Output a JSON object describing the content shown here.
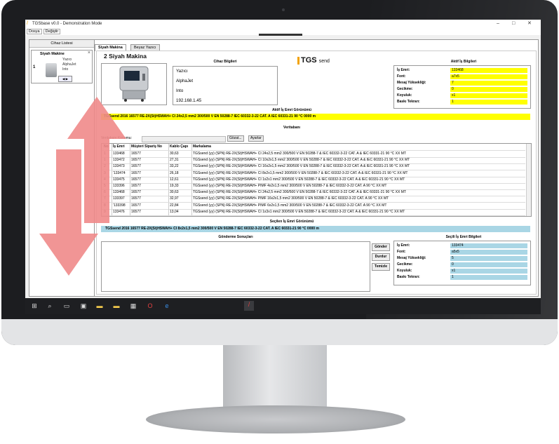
{
  "window": {
    "title": "TGSbase v0.0 - Demonstration Mode",
    "minimize": "–",
    "maximize": "□",
    "close": "✕"
  },
  "menu": [
    "Dosya",
    "Değiştir"
  ],
  "left_panel": {
    "header": "Cihaz Listesi",
    "card": {
      "name": "Siyah Makine",
      "number": "1",
      "lines": [
        "Yazıcı",
        "AlphaJet",
        "Into"
      ],
      "control": "◀ ▶"
    }
  },
  "tabs": [
    "Siyah Makina",
    "Beyaz Yazıcı"
  ],
  "machine_title": "2   Siyah Makina",
  "cihaz": {
    "header": "Cihaz Bilgileri",
    "lines": [
      "Yazıcı",
      "AlphaJet",
      "Into",
      "192.168.1.45"
    ]
  },
  "logo": {
    "brand": "TGS",
    "suffix": "send"
  },
  "aktif": {
    "header": "Aktif İş Bilgileri",
    "rows": [
      {
        "label": "İş Emri:",
        "value": "133468"
      },
      {
        "label": "Font:",
        "value": "a7x5"
      },
      {
        "label": "Mesaj Yüksekliği:",
        "value": "7"
      },
      {
        "label": "Gecikme:",
        "value": "0"
      },
      {
        "label": "Koyuluk:",
        "value": "x1"
      },
      {
        "label": "Baskı Tekrarı:",
        "value": "1"
      }
    ]
  },
  "aktif_band": {
    "label": "Aktif İş Emri Görünümü",
    "text": "TGSsend 2016 16577 RE-2X(St)HSWAH+ CI 24x2,5 mm2 300/500 V EN 50288-7 IEC 60332-3-22 CAT. A IEC 60331-21 90 °C 0000 m"
  },
  "veritabani": {
    "label": "Veritabanı",
    "konum_label": "Veritabanı Konumu:",
    "gozat": "Gözat...",
    "ayarlar": "Ayarlar",
    "columns": [
      "No",
      "İş Emri",
      "Müşteri Sipariş No",
      "Kablo Çapı",
      "Markalama"
    ],
    "rows": [
      [
        "1",
        "133468",
        "16577",
        "30,63",
        "TGSsend (yy) (SPN) RE-2X(St)HSWAH+ CI 24x2,5 mm2 300/500 V EN 50288-7 & IEC 60332-3-22 CAT. A & IEC 60331-21 90 °C XX MT"
      ],
      [
        "1",
        "133472",
        "16577",
        "27,31",
        "TGSsend (yy) (SPN) RE-2X(St)HSWAH+ CI 10x2x1,5 mm2 300/500 V EN 50288-7 & IEC 60332-3-22 CAT. A & IEC 60331-21 90 °C XX MT"
      ],
      [
        "2",
        "133473",
        "16577",
        "33,22",
        "TGSsend (yy) (SPN) RE-2X(St)HSWAH+ CI 16x2x1,5 mm2 300/500 V EN 50288-7 & IEC 60332-3-22 CAT. A & IEC 60331-21 90 °C XX MT"
      ],
      [
        "3",
        "'133474",
        "16577",
        "26,18",
        "TGSsend (yy) (SPN) RE-2X(St)HSWAH+ CI 8x2x1,5 mm2 300/500 V EN 50288-7 & IEC 60332-3-22 CAT. A & IEC 60331-21 90 °C XX MT"
      ],
      [
        "4",
        "133475",
        "16577",
        "12,61",
        "TGSsend (yy) (SPN) RE-2X(St)HSWAH+ CI 1x2x1 mm2 300/500 V EN 50288-7 & IEC 60332-3-22 CAT. A & IEC 60331-21 90 °C XX MT"
      ],
      [
        "5",
        "133396",
        "16577",
        "19,33",
        "TGSsend (yy) (SPN) RE-2X(St)HSWAH+ PIMF 4x2x1,5 mm2 300/500 V EN 50288-7 & IEC 60332-3-22 CAT. A 90 °C XX MT"
      ],
      [
        "6",
        "133468",
        "16577",
        "30,63",
        "TGSsend (yy) (SPN) RE-2X(St)HSWAH+ CI 24x2,5 mm2 300/500 V EN 50288-7 & IEC 60332-3-22 CAT. A & IEC 60331-21 90 °C XX MT"
      ],
      [
        "7",
        "133397",
        "16577",
        "32,97",
        "TGSsend (yy) (SPN) RE-2X(St)HSWAH+ PIMF 16x2x1,5 mm2 300/500 V EN 50288-7 & IEC 60332-3-22 CAT. A 90 °C XX MT"
      ],
      [
        "8",
        "'133398",
        "16577",
        "22,84",
        "TGSsend (yy) (SPN) RE-2X(St)HSWAH+ PIMF 6x2x1,5 mm2 300/500 V EN 50288-7 & IEC 60332-3-22 CAT. A 90 °C XX MT"
      ],
      [
        "9",
        "133476",
        "16577",
        "13,04",
        "TGSsend (yy) (SPN) RE-2X(St)HSWAH+ CI 1x3x1 mm2 300/500 V EN 50288-7 & IEC 60332-3-22 CAT. A & IEC 60331-21 90 °C XX MT"
      ]
    ]
  },
  "secilen_band": {
    "label": "Seçilen İş Emri Görünümü",
    "text": "TGSsend 2016 16577 RE-2X(St)HSWAH+ CI 8x2x1,5 mm2 300/500 V EN 50288-7 IEC 60332-3-22 CAT. A IEC 60331-21 90 °C 0000 m"
  },
  "gonderme": {
    "label": "Gönderme Sonuçları",
    "buttons": [
      "Gönder",
      "Durdur",
      "Temizle"
    ]
  },
  "secili": {
    "header": "Seçili İş Emri Bilgileri",
    "rows": [
      {
        "label": "İş Emri:",
        "value": "133474"
      },
      {
        "label": "Font:",
        "value": "a5x5"
      },
      {
        "label": "Mesaj Yüksekliği:",
        "value": "5"
      },
      {
        "label": "Gecikme:",
        "value": "0"
      },
      {
        "label": "Koyuluk:",
        "value": "x1"
      },
      {
        "label": "Baskı Tekrarı:",
        "value": "1"
      }
    ]
  },
  "colors": {
    "active_highlight": "#ffff00",
    "selected_highlight": "#a9d6e5",
    "brand_accent": "#f2a200",
    "arrow": "#f08a8a"
  }
}
